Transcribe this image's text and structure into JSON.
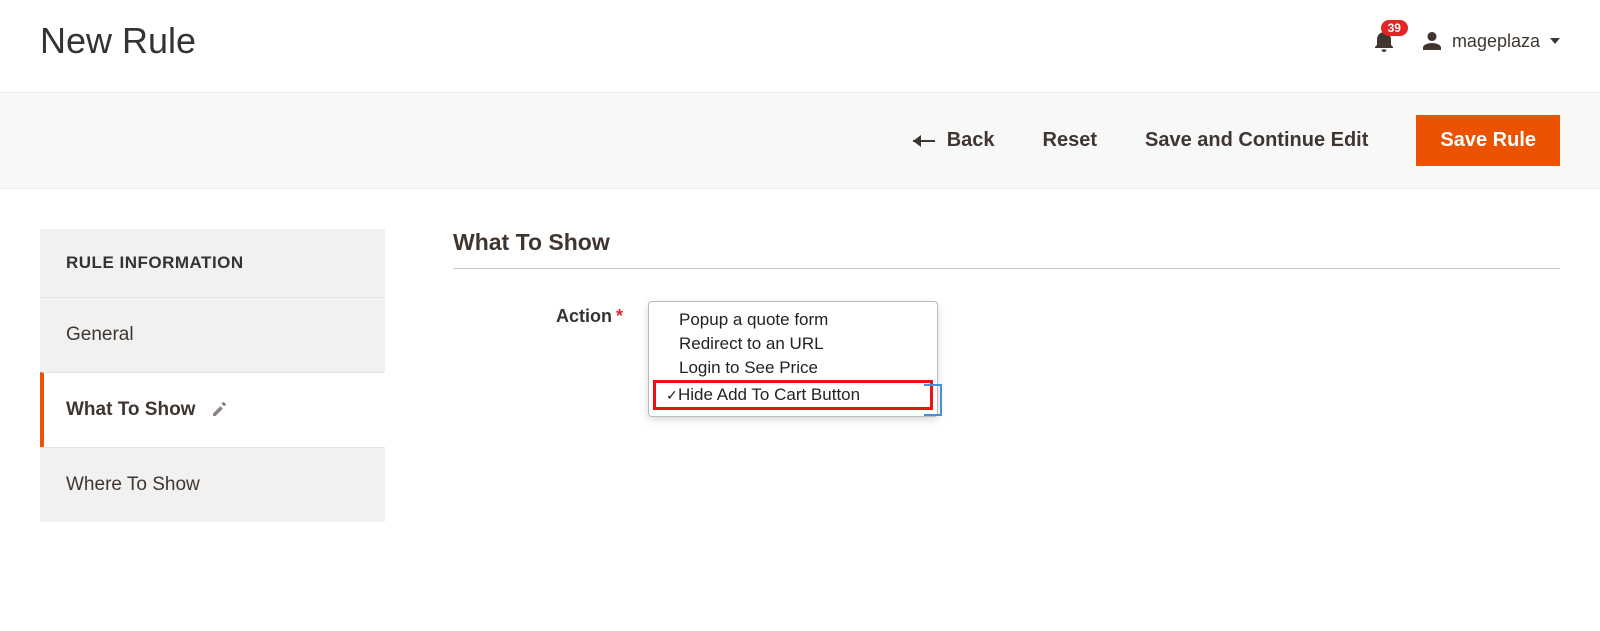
{
  "header": {
    "title": "New Rule",
    "notification_count": "39",
    "account_name": "mageplaza"
  },
  "action_bar": {
    "back": "Back",
    "reset": "Reset",
    "save_continue": "Save and Continue Edit",
    "save": "Save Rule"
  },
  "sidebar": {
    "title": "RULE INFORMATION",
    "items": [
      {
        "label": "General"
      },
      {
        "label": "What To Show"
      },
      {
        "label": "Where To Show"
      }
    ]
  },
  "main": {
    "section_title": "What To Show",
    "action_label": "Action",
    "action_options": [
      "Popup a quote form",
      "Redirect to an URL",
      "Login to See Price",
      "Hide Add To Cart Button"
    ],
    "action_selected": "Hide Add To Cart Button"
  }
}
